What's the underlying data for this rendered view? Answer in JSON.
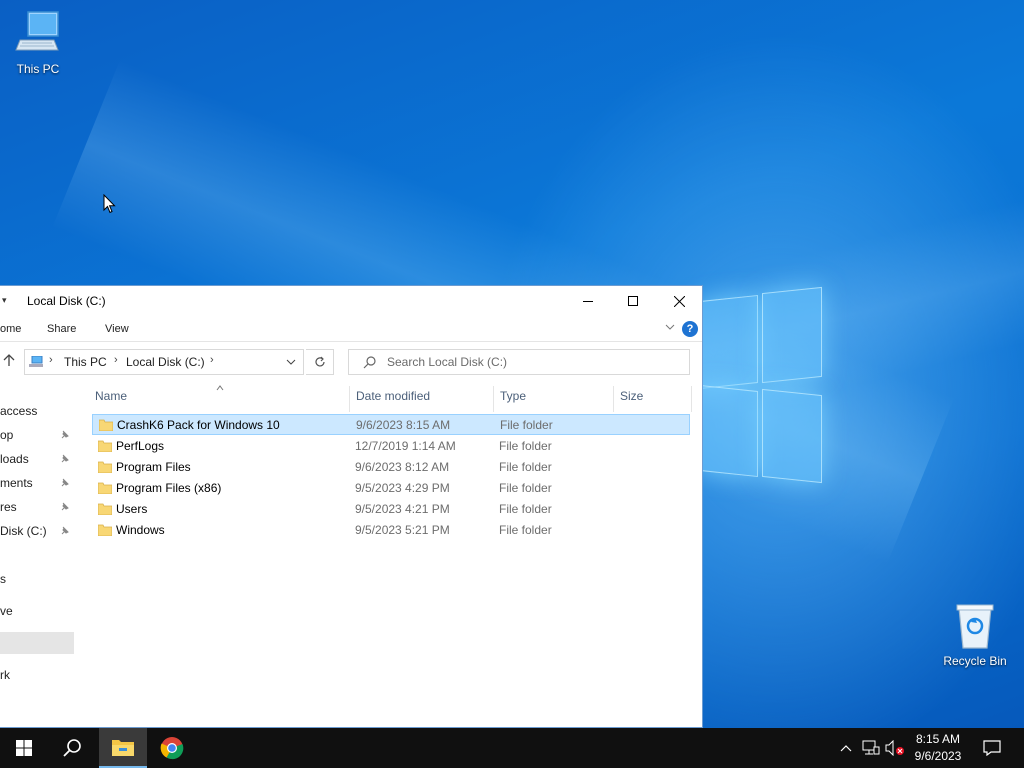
{
  "desktop": {
    "icons": [
      {
        "label": "This PC",
        "icon": "computer-icon"
      },
      {
        "label": "Recycle Bin",
        "icon": "recycle-bin-icon"
      }
    ],
    "accent": "#0b78d8"
  },
  "explorer": {
    "title": "Local Disk (C:)",
    "ribbon_tabs": [
      "ome",
      "Share",
      "View"
    ],
    "address": {
      "crumbs": [
        "This PC",
        "Local Disk (C:)"
      ]
    },
    "search_placeholder": "Search Local Disk (C:)",
    "nav_items": [
      {
        "label": "access",
        "pinned": false
      },
      {
        "label": "op",
        "pinned": true
      },
      {
        "label": "loads",
        "pinned": true
      },
      {
        "label": "ments",
        "pinned": true
      },
      {
        "label": "res",
        "pinned": true
      },
      {
        "label": "Disk (C:)",
        "pinned": true
      },
      {
        "label": "",
        "pinned": false
      },
      {
        "label": "s",
        "pinned": false
      },
      {
        "label": "ve",
        "pinned": false
      },
      {
        "label": "",
        "pinned": false,
        "selected": true
      },
      {
        "label": "rk",
        "pinned": false
      }
    ],
    "columns": [
      "Name",
      "Date modified",
      "Type",
      "Size"
    ],
    "files": [
      {
        "name": "CrashK6 Pack for Windows 10",
        "date": "9/6/2023 8:15 AM",
        "type": "File folder",
        "selected": true
      },
      {
        "name": "PerfLogs",
        "date": "12/7/2019 1:14 AM",
        "type": "File folder"
      },
      {
        "name": "Program Files",
        "date": "9/6/2023 8:12 AM",
        "type": "File folder"
      },
      {
        "name": "Program Files (x86)",
        "date": "9/5/2023 4:29 PM",
        "type": "File folder"
      },
      {
        "name": "Users",
        "date": "9/5/2023 4:21 PM",
        "type": "File folder"
      },
      {
        "name": "Windows",
        "date": "9/5/2023 5:21 PM",
        "type": "File folder"
      }
    ],
    "selection_color": "#cce8ff"
  },
  "taskbar": {
    "clock_time": "8:15 AM",
    "clock_date": "9/6/2023",
    "apps": [
      "start-icon",
      "search-icon",
      "file-explorer-icon",
      "chrome-icon"
    ]
  }
}
